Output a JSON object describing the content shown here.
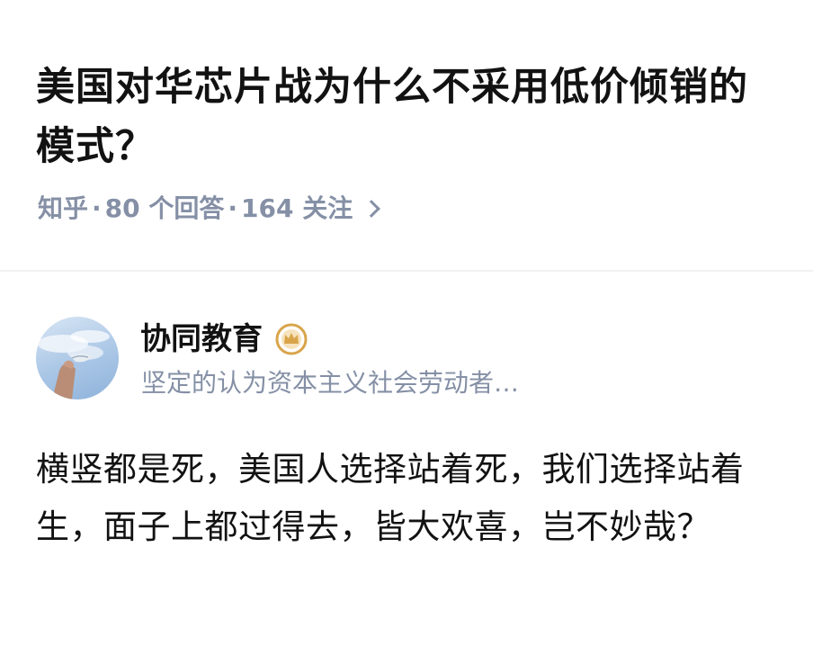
{
  "question": {
    "title": "美国对华芯片战为什么不采用低价倾销的模式？"
  },
  "meta": {
    "source": "知乎",
    "answers": "80 个回答",
    "followers": "164 关注",
    "separator": "·",
    "chevron_icon": "chevron-right-icon"
  },
  "author": {
    "name": "协同教育",
    "bio": "坚定的认为资本主义社会劳动者…",
    "badge_icon": "crown-badge-icon",
    "badge_color": "#d9a54b"
  },
  "answer": {
    "text": "横竖都是死，美国人选择站着死，我们选择站着生，面子上都过得去，皆大欢喜，岂不妙哉？"
  }
}
